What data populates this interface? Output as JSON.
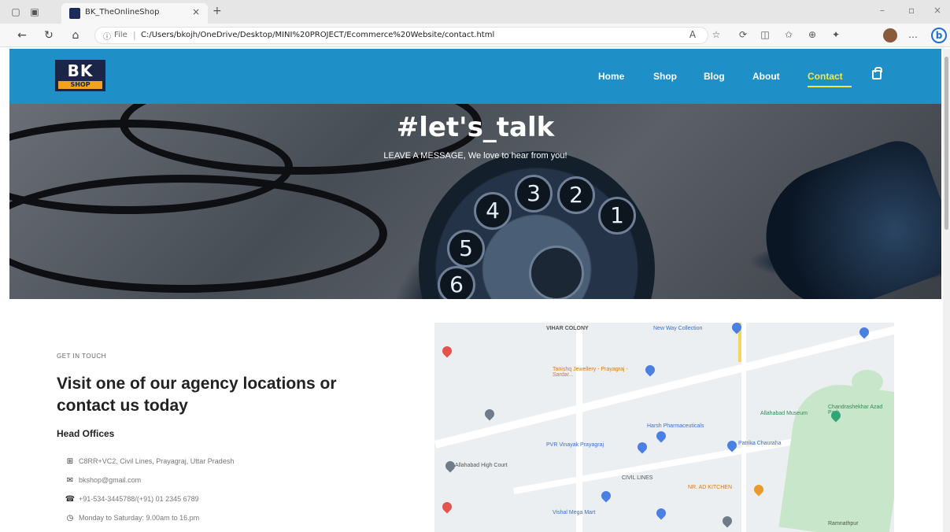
{
  "browser": {
    "tab_title": "BK_TheOnlineShop",
    "url_scheme": "File",
    "url": "C:/Users/bkojh/OneDrive/Desktop/MINI%20PROJECT/Ecommerce%20Website/contact.html"
  },
  "site": {
    "logo_top": "BK",
    "logo_bottom": "SHOP",
    "nav": [
      "Home",
      "Shop",
      "Blog",
      "About",
      "Contact"
    ],
    "active_nav": "Contact",
    "accent_color": "#1e8fc7",
    "active_color": "#f3e84a"
  },
  "hero": {
    "title": "#let's_talk",
    "subtitle": "LEAVE A MESSAGE, We love to hear from you!",
    "dial_numbers": [
      "4",
      "3",
      "2",
      "1",
      "5",
      "6"
    ]
  },
  "contact": {
    "eyebrow": "GET IN TOUCH",
    "heading": "Visit one of our agency locations or contact us today",
    "offices_title": "Head Offices",
    "items": [
      {
        "icon": "map-icon",
        "text": "C8RR+VC2, Civil Lines, Prayagraj, Uttar Pradesh"
      },
      {
        "icon": "envelope-icon",
        "text": "bkshop@gmail.com"
      },
      {
        "icon": "phone-icon",
        "text": "+91-534-3445788/(+91) 01 2345 6789"
      },
      {
        "icon": "clock-icon",
        "text": "Monday to Saturday: 9.00am to 16.pm"
      }
    ]
  },
  "map": {
    "labels": [
      "VIHAR COLONY",
      "New Way Collection",
      "Tanishq Jewellery - Prayagraj - Sardar...",
      "Allahabad Museum",
      "Harsh Pharmaceuticals",
      "PVR Vinayak Prayagraj",
      "Patrika Chauraha",
      "Allahabad High Court",
      "NR. AD KITCHEN",
      "Vishal Mega Mart",
      "Chandrashekhar Azad Park",
      "Ramnathpur",
      "CIVIL LINES"
    ]
  }
}
